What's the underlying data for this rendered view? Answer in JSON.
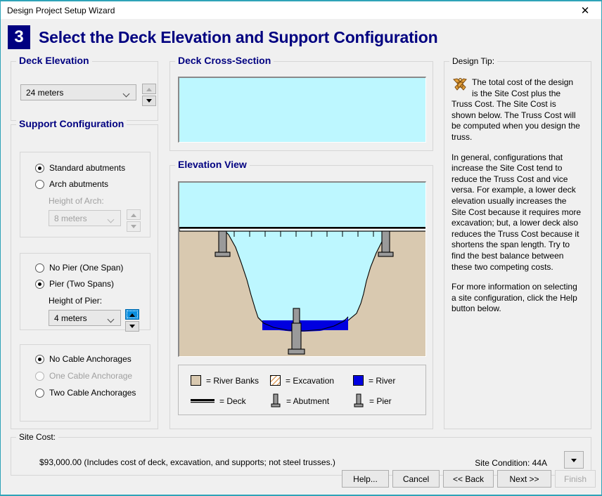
{
  "window": {
    "title": "Design Project Setup Wizard",
    "close_icon": "close-icon"
  },
  "header": {
    "step_number": "3",
    "title": "Select the Deck Elevation and Support Configuration"
  },
  "deck_elevation": {
    "legend": "Deck Elevation",
    "value": "24 meters"
  },
  "support_configuration": {
    "legend": "Support Configuration",
    "abutments": {
      "options": [
        {
          "label": "Standard abutments",
          "checked": true,
          "disabled": false
        },
        {
          "label": "Arch abutments",
          "checked": false,
          "disabled": false
        }
      ],
      "height_label": "Height of Arch:",
      "height_value": "8 meters"
    },
    "piers": {
      "options": [
        {
          "label": "No Pier (One Span)",
          "checked": false,
          "disabled": false
        },
        {
          "label": "Pier (Two Spans)",
          "checked": true,
          "disabled": false
        }
      ],
      "height_label": "Height of Pier:",
      "height_value": "4 meters"
    },
    "anchorages": {
      "options": [
        {
          "label": "No Cable Anchorages",
          "checked": true,
          "disabled": false
        },
        {
          "label": "One Cable Anchorage",
          "checked": false,
          "disabled": true
        },
        {
          "label": "Two Cable Anchorages",
          "checked": false,
          "disabled": false
        }
      ]
    }
  },
  "deck_cross_section": {
    "legend": "Deck Cross-Section"
  },
  "elevation_view": {
    "legend": "Elevation View",
    "legend_items": [
      {
        "label": "= River Banks",
        "swatch": "river-banks-swatch",
        "color": "#d9c9b0"
      },
      {
        "label": "= Excavation",
        "swatch": "excavation-swatch",
        "color": "#ffffff"
      },
      {
        "label": "= River",
        "swatch": "river-swatch",
        "color": "#0000e0"
      },
      {
        "label": "= Deck",
        "swatch": "deck-swatch",
        "color": "#000000"
      },
      {
        "label": "= Abutment",
        "swatch": "abutment-swatch",
        "color": "#9a9a9a"
      },
      {
        "label": "= Pier",
        "swatch": "pier-swatch",
        "color": "#9a9a9a"
      }
    ]
  },
  "design_tip": {
    "legend": "Design Tip:",
    "icon": "drafting-compass-icon",
    "paragraph1": "The total cost of the design is the Site Cost plus the Truss Cost. The Site Cost is shown below. The Truss Cost will be computed when you design the truss.",
    "paragraph2": "In general, configurations that increase the Site Cost tend to reduce the Truss Cost and vice versa. For example, a lower deck elevation usually increases the Site Cost because it requires more excavation; but, a lower deck also reduces the Truss Cost because it shortens the span length. Try to find the best balance between these two competing costs.",
    "paragraph3": "For more information on selecting a site configuration, click the Help button below."
  },
  "site_cost": {
    "legend": "Site Cost:",
    "value": "$93,000.00  (Includes cost of deck, excavation, and supports; not steel trusses.)",
    "site_condition": "Site Condition: 44A"
  },
  "buttons": {
    "help": "Help...",
    "cancel": "Cancel",
    "back": "<< Back",
    "next": "Next >>",
    "finish": "Finish"
  },
  "colors": {
    "accent": "#000080",
    "sky": "#bdf7ff",
    "bank": "#d9c9b0",
    "river": "#0000e0",
    "support": "#9a9a9a",
    "focus": "#0a8fe0",
    "titlebar_border": "#2ea3b8"
  }
}
